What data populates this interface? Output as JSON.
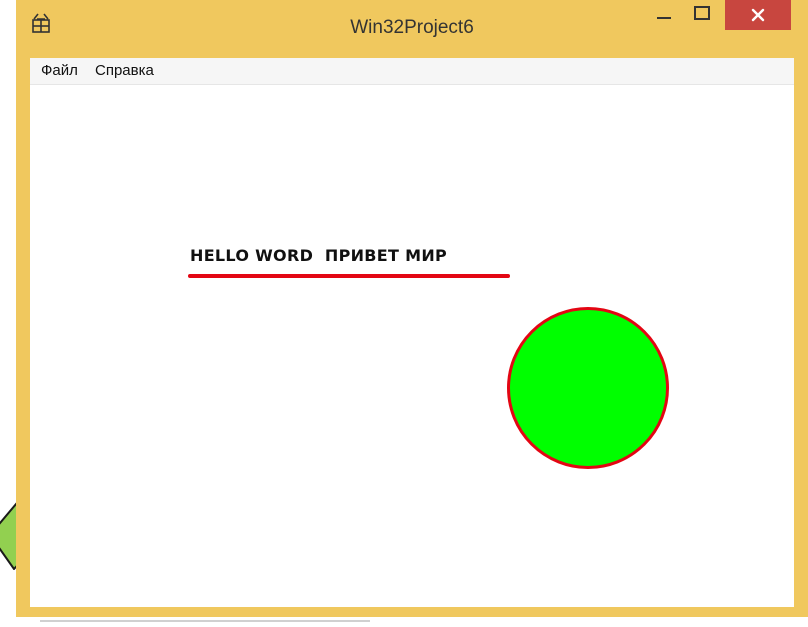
{
  "window": {
    "title": "Win32Project6",
    "frame_color": "#f0c85e",
    "controls": {
      "minimize_icon": "minimize-icon",
      "maximize_icon": "maximize-icon",
      "close_icon": "close-icon",
      "close_color": "#c8463f"
    }
  },
  "menu": {
    "items": [
      {
        "label": "Файл"
      },
      {
        "label": "Справка"
      }
    ]
  },
  "canvas": {
    "text": "HELLO WORD  ПРИВЕТ МИР",
    "underline_color": "#e30613",
    "circle_fill": "#00ff00",
    "circle_stroke": "#e30613",
    "arrow_color": "#92d050",
    "arrow_icon": "arrow-up-right-icon"
  }
}
